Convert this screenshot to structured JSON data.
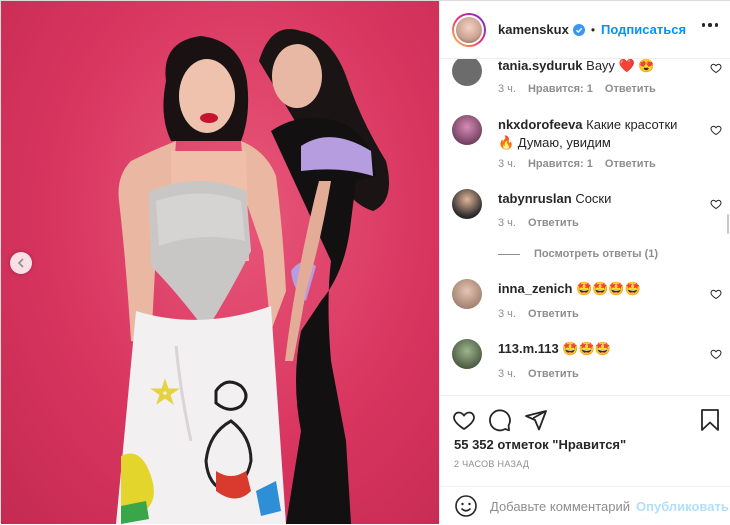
{
  "post": {
    "username": "kamenskux",
    "follow_label": "Подписаться",
    "separator": "•"
  },
  "comments": [
    {
      "user": "tania.syduruk",
      "text": "Вауу ❤️ 😍",
      "time": "3 ч.",
      "likes": "Нравится: 1",
      "reply": "Ответить"
    },
    {
      "user": "nkxdorofeeva",
      "text": "Какие красотки🔥 Думаю, увидим",
      "time": "3 ч.",
      "likes": "Нравится: 1",
      "reply": "Ответить"
    },
    {
      "user": "tabynruslan",
      "text": "Соски",
      "time": "3 ч.",
      "reply": "Ответить",
      "view_replies": "Посмотреть ответы (1)"
    },
    {
      "user": "inna_zenich",
      "text": "🤩🤩🤩🤩",
      "time": "3 ч.",
      "reply": "Ответить"
    },
    {
      "user": "113.m.113",
      "text": "🤩🤩🤩",
      "time": "3 ч.",
      "reply": "Ответить"
    }
  ],
  "footer": {
    "likes": "55 352 отметок \"Нравится\"",
    "time": "2 ЧАСОВ НАЗАД",
    "comment_placeholder": "Добавьте комментарий...",
    "publish_label": "Опубликовать"
  },
  "colors": {
    "accent": "#0095f6",
    "photo_background": "#d8355f",
    "muted": "#8e8e8e",
    "publish_disabled": "#b2dffc"
  },
  "icons": [
    "chevron-left-icon",
    "verified-icon",
    "more-icon",
    "heart-icon",
    "comment-icon",
    "share-icon",
    "bookmark-icon",
    "emoji-icon"
  ]
}
